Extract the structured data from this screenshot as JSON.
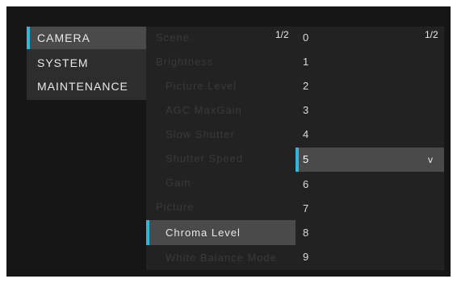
{
  "menu_main": {
    "items": [
      {
        "label": "CAMERA",
        "selected": true
      },
      {
        "label": "SYSTEM",
        "selected": false
      },
      {
        "label": "MAINTENANCE",
        "selected": false
      }
    ]
  },
  "menu_camera": {
    "page": "1/2",
    "items": [
      {
        "label": "Scene"
      },
      {
        "label": "Brightness"
      },
      {
        "label": "Picture Level"
      },
      {
        "label": "AGC MaxGain"
      },
      {
        "label": "Slow Shutter"
      },
      {
        "label": "Shutter Speed"
      },
      {
        "label": "Gain"
      },
      {
        "label": "Picture"
      },
      {
        "label": "Chroma Level",
        "selected": true
      },
      {
        "label": "White Balance Mode"
      }
    ]
  },
  "menu_values": {
    "page": "1/2",
    "items": [
      "0",
      "1",
      "2",
      "3",
      "4",
      "5",
      "6",
      "7",
      "8",
      "9"
    ],
    "selected_index": 5,
    "selected_mark": "v"
  },
  "colors": {
    "accent": "#33b6dc",
    "selected_bg": "#4a4a4a",
    "panel_bg": "#222222",
    "screen_bg": "#161616"
  }
}
